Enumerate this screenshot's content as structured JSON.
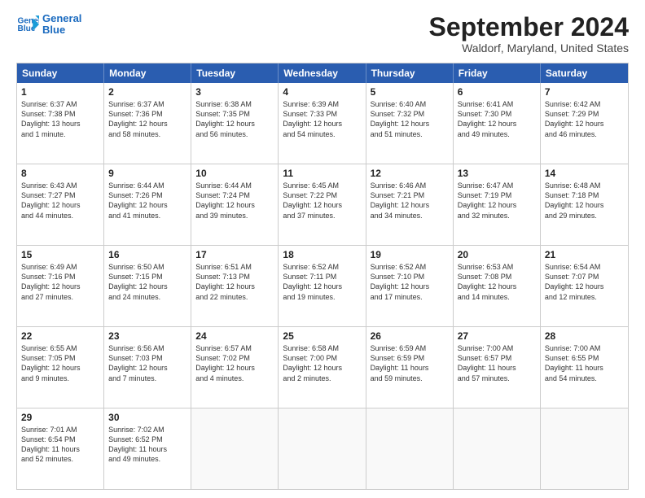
{
  "logo": {
    "line1": "General",
    "line2": "Blue"
  },
  "title": "September 2024",
  "location": "Waldorf, Maryland, United States",
  "days_of_week": [
    "Sunday",
    "Monday",
    "Tuesday",
    "Wednesday",
    "Thursday",
    "Friday",
    "Saturday"
  ],
  "weeks": [
    [
      {
        "day": 1,
        "lines": [
          "Sunrise: 6:37 AM",
          "Sunset: 7:38 PM",
          "Daylight: 13 hours",
          "and 1 minute."
        ]
      },
      {
        "day": 2,
        "lines": [
          "Sunrise: 6:37 AM",
          "Sunset: 7:36 PM",
          "Daylight: 12 hours",
          "and 58 minutes."
        ]
      },
      {
        "day": 3,
        "lines": [
          "Sunrise: 6:38 AM",
          "Sunset: 7:35 PM",
          "Daylight: 12 hours",
          "and 56 minutes."
        ]
      },
      {
        "day": 4,
        "lines": [
          "Sunrise: 6:39 AM",
          "Sunset: 7:33 PM",
          "Daylight: 12 hours",
          "and 54 minutes."
        ]
      },
      {
        "day": 5,
        "lines": [
          "Sunrise: 6:40 AM",
          "Sunset: 7:32 PM",
          "Daylight: 12 hours",
          "and 51 minutes."
        ]
      },
      {
        "day": 6,
        "lines": [
          "Sunrise: 6:41 AM",
          "Sunset: 7:30 PM",
          "Daylight: 12 hours",
          "and 49 minutes."
        ]
      },
      {
        "day": 7,
        "lines": [
          "Sunrise: 6:42 AM",
          "Sunset: 7:29 PM",
          "Daylight: 12 hours",
          "and 46 minutes."
        ]
      }
    ],
    [
      {
        "day": 8,
        "lines": [
          "Sunrise: 6:43 AM",
          "Sunset: 7:27 PM",
          "Daylight: 12 hours",
          "and 44 minutes."
        ]
      },
      {
        "day": 9,
        "lines": [
          "Sunrise: 6:44 AM",
          "Sunset: 7:26 PM",
          "Daylight: 12 hours",
          "and 41 minutes."
        ]
      },
      {
        "day": 10,
        "lines": [
          "Sunrise: 6:44 AM",
          "Sunset: 7:24 PM",
          "Daylight: 12 hours",
          "and 39 minutes."
        ]
      },
      {
        "day": 11,
        "lines": [
          "Sunrise: 6:45 AM",
          "Sunset: 7:22 PM",
          "Daylight: 12 hours",
          "and 37 minutes."
        ]
      },
      {
        "day": 12,
        "lines": [
          "Sunrise: 6:46 AM",
          "Sunset: 7:21 PM",
          "Daylight: 12 hours",
          "and 34 minutes."
        ]
      },
      {
        "day": 13,
        "lines": [
          "Sunrise: 6:47 AM",
          "Sunset: 7:19 PM",
          "Daylight: 12 hours",
          "and 32 minutes."
        ]
      },
      {
        "day": 14,
        "lines": [
          "Sunrise: 6:48 AM",
          "Sunset: 7:18 PM",
          "Daylight: 12 hours",
          "and 29 minutes."
        ]
      }
    ],
    [
      {
        "day": 15,
        "lines": [
          "Sunrise: 6:49 AM",
          "Sunset: 7:16 PM",
          "Daylight: 12 hours",
          "and 27 minutes."
        ]
      },
      {
        "day": 16,
        "lines": [
          "Sunrise: 6:50 AM",
          "Sunset: 7:15 PM",
          "Daylight: 12 hours",
          "and 24 minutes."
        ]
      },
      {
        "day": 17,
        "lines": [
          "Sunrise: 6:51 AM",
          "Sunset: 7:13 PM",
          "Daylight: 12 hours",
          "and 22 minutes."
        ]
      },
      {
        "day": 18,
        "lines": [
          "Sunrise: 6:52 AM",
          "Sunset: 7:11 PM",
          "Daylight: 12 hours",
          "and 19 minutes."
        ]
      },
      {
        "day": 19,
        "lines": [
          "Sunrise: 6:52 AM",
          "Sunset: 7:10 PM",
          "Daylight: 12 hours",
          "and 17 minutes."
        ]
      },
      {
        "day": 20,
        "lines": [
          "Sunrise: 6:53 AM",
          "Sunset: 7:08 PM",
          "Daylight: 12 hours",
          "and 14 minutes."
        ]
      },
      {
        "day": 21,
        "lines": [
          "Sunrise: 6:54 AM",
          "Sunset: 7:07 PM",
          "Daylight: 12 hours",
          "and 12 minutes."
        ]
      }
    ],
    [
      {
        "day": 22,
        "lines": [
          "Sunrise: 6:55 AM",
          "Sunset: 7:05 PM",
          "Daylight: 12 hours",
          "and 9 minutes."
        ]
      },
      {
        "day": 23,
        "lines": [
          "Sunrise: 6:56 AM",
          "Sunset: 7:03 PM",
          "Daylight: 12 hours",
          "and 7 minutes."
        ]
      },
      {
        "day": 24,
        "lines": [
          "Sunrise: 6:57 AM",
          "Sunset: 7:02 PM",
          "Daylight: 12 hours",
          "and 4 minutes."
        ]
      },
      {
        "day": 25,
        "lines": [
          "Sunrise: 6:58 AM",
          "Sunset: 7:00 PM",
          "Daylight: 12 hours",
          "and 2 minutes."
        ]
      },
      {
        "day": 26,
        "lines": [
          "Sunrise: 6:59 AM",
          "Sunset: 6:59 PM",
          "Daylight: 11 hours",
          "and 59 minutes."
        ]
      },
      {
        "day": 27,
        "lines": [
          "Sunrise: 7:00 AM",
          "Sunset: 6:57 PM",
          "Daylight: 11 hours",
          "and 57 minutes."
        ]
      },
      {
        "day": 28,
        "lines": [
          "Sunrise: 7:00 AM",
          "Sunset: 6:55 PM",
          "Daylight: 11 hours",
          "and 54 minutes."
        ]
      }
    ],
    [
      {
        "day": 29,
        "lines": [
          "Sunrise: 7:01 AM",
          "Sunset: 6:54 PM",
          "Daylight: 11 hours",
          "and 52 minutes."
        ]
      },
      {
        "day": 30,
        "lines": [
          "Sunrise: 7:02 AM",
          "Sunset: 6:52 PM",
          "Daylight: 11 hours",
          "and 49 minutes."
        ]
      },
      {
        "day": null,
        "lines": []
      },
      {
        "day": null,
        "lines": []
      },
      {
        "day": null,
        "lines": []
      },
      {
        "day": null,
        "lines": []
      },
      {
        "day": null,
        "lines": []
      }
    ]
  ]
}
